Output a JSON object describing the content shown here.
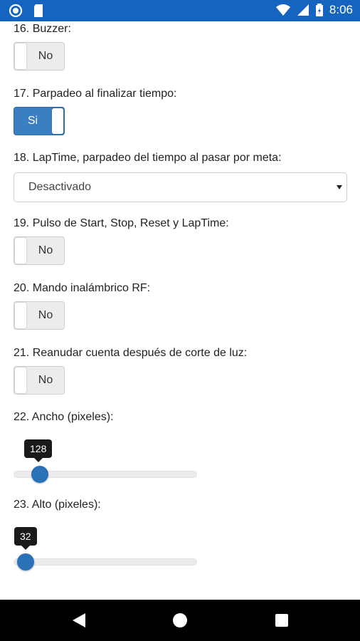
{
  "status_bar": {
    "time": "8:06",
    "icons": [
      "sync-icon",
      "sd-card-icon",
      "wifi-icon",
      "signal-icon",
      "battery-icon"
    ],
    "color": "#1565c0"
  },
  "settings": {
    "s16": {
      "label": "16. Buzzer:",
      "value": "No",
      "on": false
    },
    "s17": {
      "label": "17. Parpadeo al finalizar tiempo:",
      "value": "Si",
      "on": true
    },
    "s18": {
      "label": "18. LapTime, parpadeo del tiempo al pasar por meta:",
      "value": "Desactivado"
    },
    "s19": {
      "label": "19. Pulso de Start, Stop, Reset y LapTime:",
      "value": "No",
      "on": false
    },
    "s20": {
      "label": "20. Mando inalámbrico RF:",
      "value": "No",
      "on": false
    },
    "s21": {
      "label": "21. Reanudar cuenta después de corte de luz:",
      "value": "No",
      "on": false
    },
    "s22": {
      "label": "22. Ancho (pixeles):",
      "value": "128"
    },
    "s23": {
      "label": "23. Alto (pixeles):",
      "value": "32"
    }
  },
  "colors": {
    "accent": "#3a7fc1",
    "slider_thumb": "#2a72b8"
  },
  "nav_bar": {
    "icons": [
      "back-icon",
      "home-icon",
      "recents-icon"
    ]
  }
}
